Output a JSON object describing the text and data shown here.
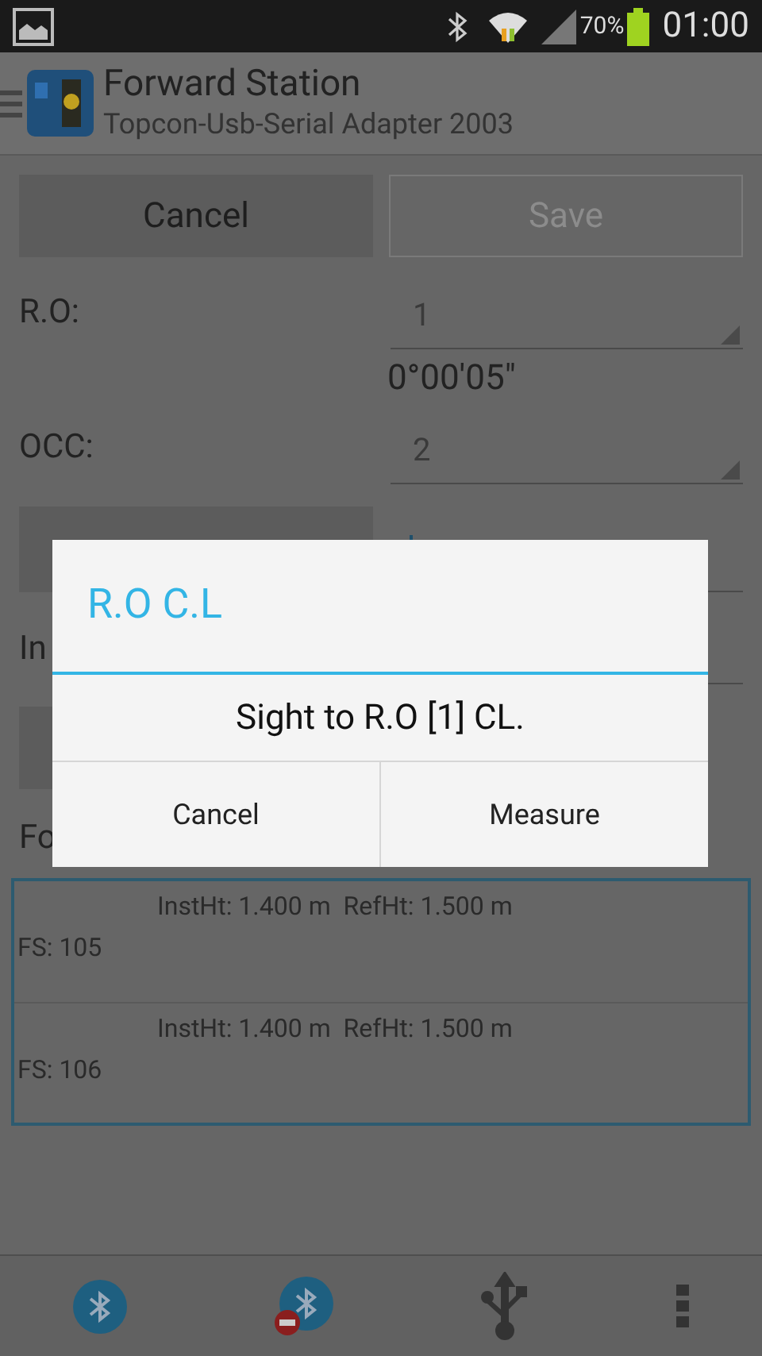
{
  "status_bar": {
    "battery": "70%",
    "time": "01:00"
  },
  "action_bar": {
    "title": "Forward Station",
    "subtitle": "Topcon-Usb-Serial Adapter 2003"
  },
  "buttons": [
    {
      "label": "Cancel",
      "disabled": false
    },
    {
      "label": "Save",
      "disabled": true
    }
  ],
  "ro": {
    "label": "R.O:",
    "value": "1",
    "angle": "0°00'05\""
  },
  "occ": {
    "label": "OCC:",
    "value": "2"
  },
  "partial_labels": [
    "In",
    "Fo"
  ],
  "list": [
    {
      "heights": "InstHt: 1.400 m  RefHt: 1.500 m",
      "fs": "FS: 105"
    },
    {
      "heights": "InstHt: 1.400 m  RefHt: 1.500 m",
      "fs": "FS: 106"
    }
  ],
  "dialog": {
    "title": "R.O C.L",
    "message": "Sight to R.O [1] CL.",
    "buttons": [
      "Cancel",
      "Measure"
    ]
  }
}
